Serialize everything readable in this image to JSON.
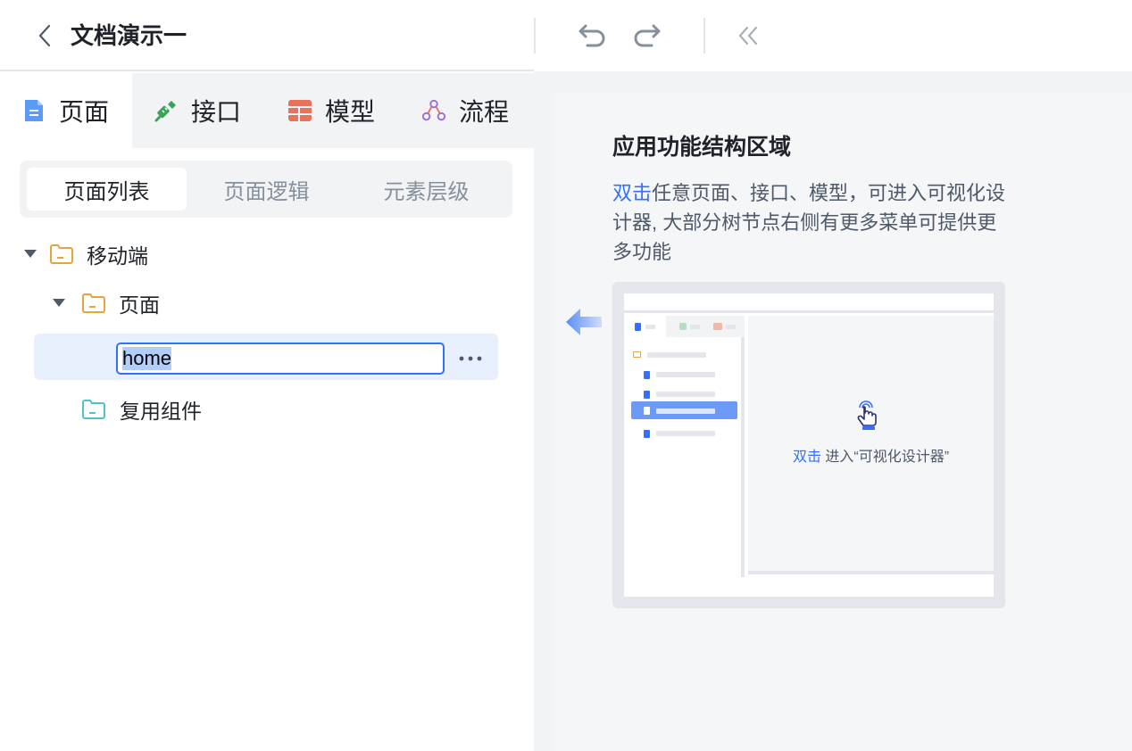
{
  "header": {
    "title": "文档演示一",
    "back_icon": "chevron-left-icon",
    "undo_icon": "undo-icon",
    "redo_icon": "redo-icon",
    "collapse_icon": "double-chevron-left-icon"
  },
  "main_tabs": [
    {
      "label": "页面",
      "icon": "page-doc-icon",
      "active": true
    },
    {
      "label": "接口",
      "icon": "plug-icon",
      "active": false
    },
    {
      "label": "模型",
      "icon": "table-icon",
      "active": false
    },
    {
      "label": "流程",
      "icon": "flow-icon",
      "active": false
    }
  ],
  "segments": [
    {
      "label": "页面列表",
      "active": true
    },
    {
      "label": "页面逻辑",
      "active": false
    },
    {
      "label": "元素层级",
      "active": false
    }
  ],
  "tree": {
    "root": {
      "label": "移动端",
      "expanded": true
    },
    "pages_folder": {
      "label": "页面",
      "expanded": true
    },
    "editing_item": {
      "value": "home"
    },
    "reuse_folder": {
      "label": "复用组件"
    }
  },
  "right_panel": {
    "title": "应用功能结构区域",
    "desc_highlight": "双击",
    "desc_rest": "任意页面、接口、模型，可进入可视化设计器, 大部分树节点右侧有更多菜单可提供更多功能",
    "illus_caption_highlight": "双击",
    "illus_caption_rest": " 进入“可视化设计器”"
  },
  "colors": {
    "accent": "#3370ff",
    "folder_orange": "#e8a33a",
    "folder_teal": "#4fc4c8",
    "table_red": "#e8735a",
    "flow_purple": "#9b6be0",
    "plug_green": "#3aa35a"
  }
}
